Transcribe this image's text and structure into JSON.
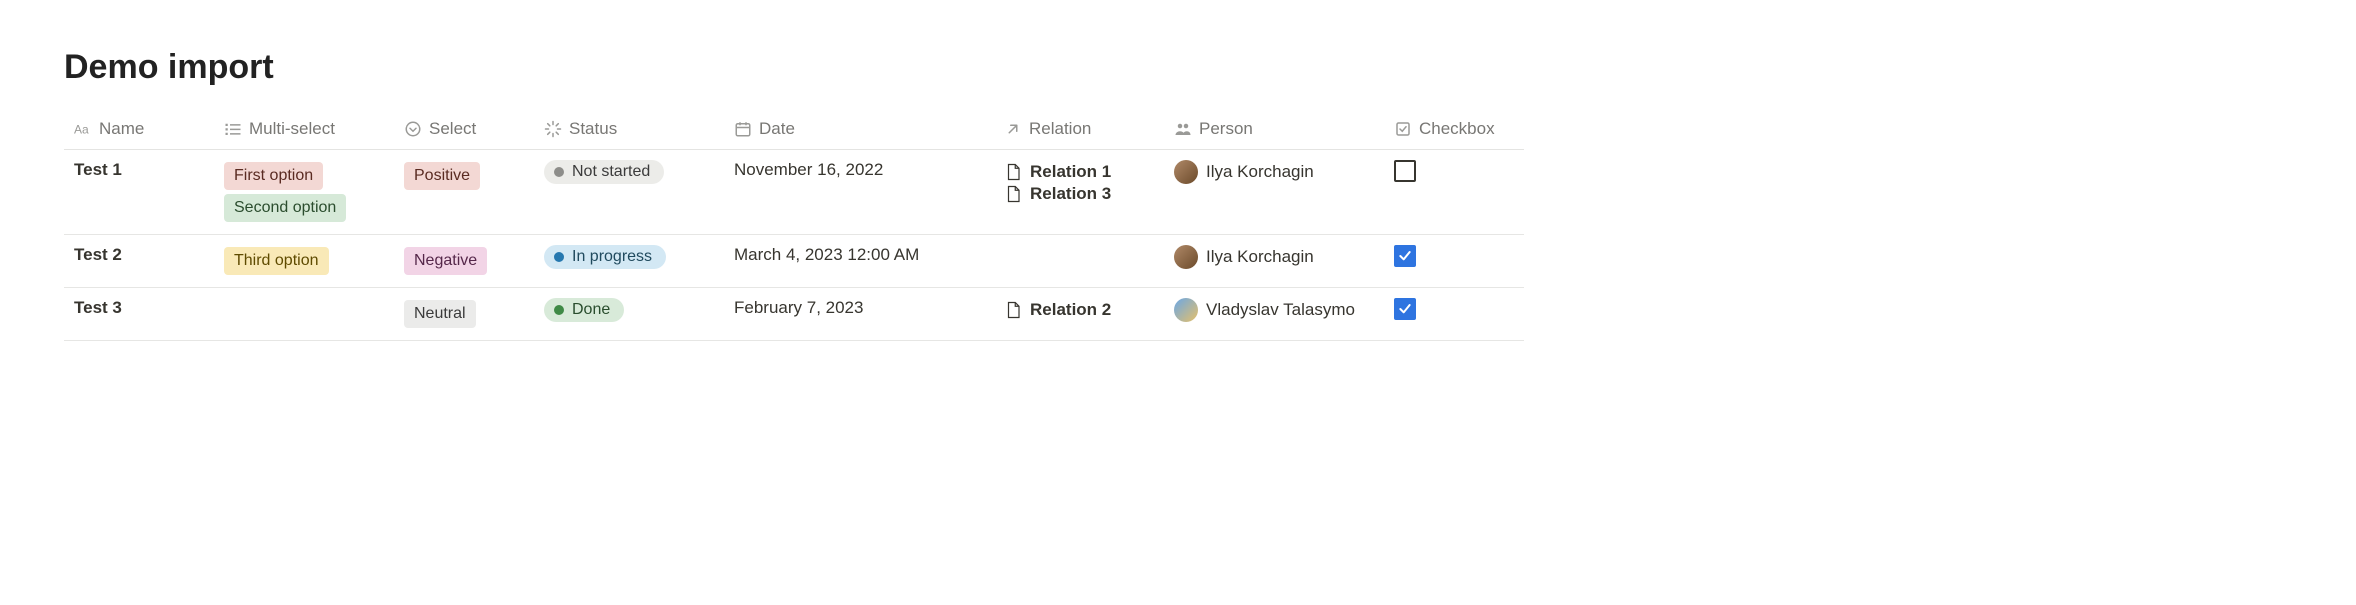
{
  "title": "Demo import",
  "columns": {
    "name": "Name",
    "multi_select": "Multi-select",
    "select": "Select",
    "status": "Status",
    "date": "Date",
    "relation": "Relation",
    "person": "Person",
    "checkbox": "Checkbox"
  },
  "tag_colors": {
    "First option": "tag-red",
    "Second option": "tag-green",
    "Third option": "tag-yellow",
    "Positive": "tag-red",
    "Negative": "tag-pink",
    "Neutral": "tag-gray"
  },
  "status_classes": {
    "Not started": "status-notstarted",
    "In progress": "status-inprogress",
    "Done": "status-done"
  },
  "avatars": {
    "Ilya Korchagin": "linear-gradient(135deg,#b08968 0%,#6b4a2a 100%)",
    "Vladyslav Talasymo": "linear-gradient(135deg,#6aa7e6 0%,#e6c06a 100%)"
  },
  "rows": [
    {
      "name": "Test 1",
      "multi_select": [
        "First option",
        "Second option"
      ],
      "select": "Positive",
      "status": "Not started",
      "date": "November 16, 2022",
      "relation": [
        "Relation 1",
        "Relation 3"
      ],
      "person": "Ilya Korchagin",
      "checkbox": false
    },
    {
      "name": "Test 2",
      "multi_select": [
        "Third option"
      ],
      "select": "Negative",
      "status": "In progress",
      "date": "March 4, 2023 12:00 AM",
      "relation": [],
      "person": "Ilya Korchagin",
      "checkbox": true
    },
    {
      "name": "Test 3",
      "multi_select": [],
      "select": "Neutral",
      "status": "Done",
      "date": "February 7, 2023",
      "relation": [
        "Relation 2"
      ],
      "person": "Vladyslav Talasymo",
      "checkbox": true
    }
  ]
}
